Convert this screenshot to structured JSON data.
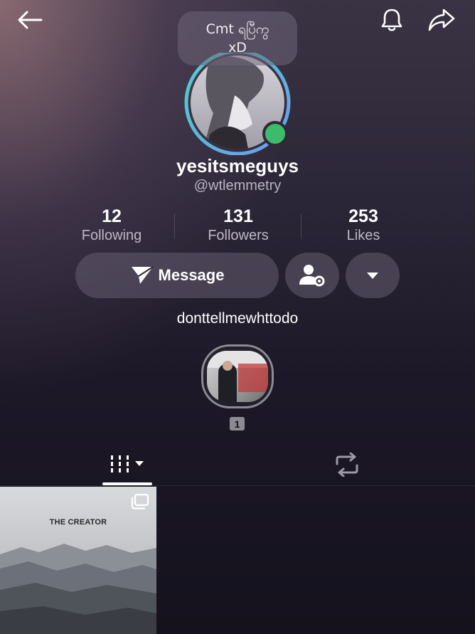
{
  "header": {
    "back_icon": "arrow-left-icon",
    "notification_icon": "bell-icon",
    "share_icon": "share-arrow-icon"
  },
  "note": {
    "line1": "Cmt ရပြီကွ",
    "line2": "xD"
  },
  "profile": {
    "username": "yesitsmeguys",
    "handle": "@wtlemmetry",
    "online_status_color": "#3dbb6a",
    "ring_gradient": [
      "#4fd1c5",
      "#6b9bf0"
    ]
  },
  "stats": [
    {
      "value": "12",
      "label": "Following"
    },
    {
      "value": "131",
      "label": "Followers"
    },
    {
      "value": "253",
      "label": "Likes"
    }
  ],
  "actions": {
    "message_label": "Message",
    "message_icon": "paper-plane-icon",
    "manage_icon": "user-gear-icon",
    "more_icon": "caret-down-icon"
  },
  "bio": "donttellmewhttodo",
  "story": {
    "count_badge": "1"
  },
  "tabs": [
    {
      "name": "posts-grid",
      "icon": "grid-columns-icon",
      "active": true
    },
    {
      "name": "reposts",
      "icon": "repost-icon",
      "active": false
    }
  ],
  "posts": [
    {
      "title": "THE CREATOR",
      "multi_icon": "multiple-images-icon"
    }
  ]
}
